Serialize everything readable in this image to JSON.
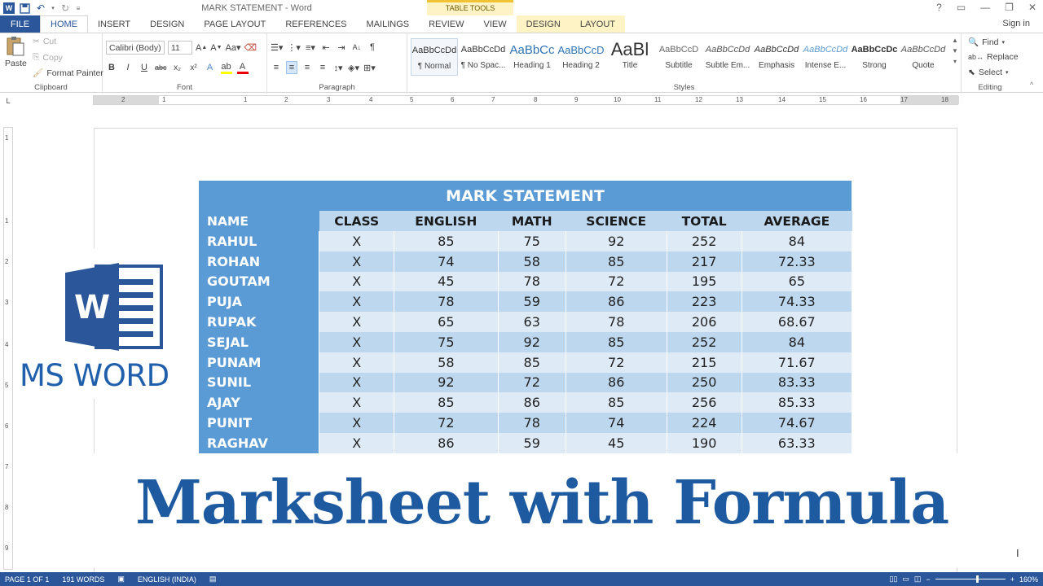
{
  "window": {
    "title": "MARK STATEMENT - Word",
    "table_tools": "TABLE TOOLS",
    "sign_in": "Sign in",
    "controls": [
      "?",
      "▭",
      "—",
      "❐",
      "✕"
    ]
  },
  "tabs": [
    {
      "label": "FILE"
    },
    {
      "label": "HOME"
    },
    {
      "label": "INSERT"
    },
    {
      "label": "DESIGN"
    },
    {
      "label": "PAGE LAYOUT"
    },
    {
      "label": "REFERENCES"
    },
    {
      "label": "MAILINGS"
    },
    {
      "label": "REVIEW"
    },
    {
      "label": "VIEW"
    },
    {
      "label": "DESIGN"
    },
    {
      "label": "LAYOUT"
    }
  ],
  "clipboard": {
    "paste": "Paste",
    "cut": "Cut",
    "copy": "Copy",
    "format_painter": "Format Painter",
    "label": "Clipboard"
  },
  "font": {
    "name": "Calibri (Body)",
    "size": "11",
    "label": "Font"
  },
  "paragraph": {
    "label": "Paragraph"
  },
  "styles": {
    "label": "Styles",
    "items": [
      {
        "sample": "AaBbCcDd",
        "name": "¶ Normal"
      },
      {
        "sample": "AaBbCcDd",
        "name": "¶ No Spac..."
      },
      {
        "sample": "AaBbCc",
        "name": "Heading 1"
      },
      {
        "sample": "AaBbCcD",
        "name": "Heading 2"
      },
      {
        "sample": "AaBl",
        "name": "Title"
      },
      {
        "sample": "AaBbCcD",
        "name": "Subtitle"
      },
      {
        "sample": "AaBbCcDd",
        "name": "Subtle Em..."
      },
      {
        "sample": "AaBbCcDd",
        "name": "Emphasis"
      },
      {
        "sample": "AaBbCcDd",
        "name": "Intense E..."
      },
      {
        "sample": "AaBbCcDc",
        "name": "Strong"
      },
      {
        "sample": "AaBbCcDd",
        "name": "Quote"
      }
    ]
  },
  "editing": {
    "find": "Find",
    "replace": "Replace",
    "select": "Select",
    "label": "Editing"
  },
  "ruler": {
    "marks": [
      "2",
      "1",
      "1",
      "2",
      "3",
      "4",
      "5",
      "6",
      "7",
      "8",
      "9",
      "10",
      "11",
      "12",
      "13",
      "14",
      "15",
      "16",
      "17",
      "18"
    ],
    "vmarks": [
      "1",
      "1",
      "2",
      "3",
      "4",
      "5",
      "6",
      "7",
      "8",
      "9"
    ],
    "corner": "L"
  },
  "table": {
    "title": "MARK STATEMENT",
    "headers": [
      "NAME",
      "CLASS",
      "ENGLISH",
      "MATH",
      "SCIENCE",
      "TOTAL",
      "AVERAGE"
    ],
    "rows": [
      [
        "RAHUL",
        "X",
        "85",
        "75",
        "92",
        "252",
        "84"
      ],
      [
        "ROHAN",
        "X",
        "74",
        "58",
        "85",
        "217",
        "72.33"
      ],
      [
        "GOUTAM",
        "X",
        "45",
        "78",
        "72",
        "195",
        "65"
      ],
      [
        "PUJA",
        "X",
        "78",
        "59",
        "86",
        "223",
        "74.33"
      ],
      [
        "RUPAK",
        "X",
        "65",
        "63",
        "78",
        "206",
        "68.67"
      ],
      [
        "SEJAL",
        "X",
        "75",
        "92",
        "85",
        "252",
        "84"
      ],
      [
        "PUNAM",
        "X",
        "58",
        "85",
        "72",
        "215",
        "71.67"
      ],
      [
        "SUNIL",
        "X",
        "92",
        "72",
        "86",
        "250",
        "83.33"
      ],
      [
        "AJAY",
        "X",
        "85",
        "86",
        "85",
        "256",
        "85.33"
      ],
      [
        "PUNIT",
        "X",
        "72",
        "78",
        "74",
        "224",
        "74.67"
      ],
      [
        "RAGHAV",
        "X",
        "86",
        "59",
        "45",
        "190",
        "63.33"
      ]
    ]
  },
  "overlay": {
    "logo_letter": "W",
    "ms_word": "MS WORD",
    "headline": "Marksheet with Formula"
  },
  "status": {
    "page": "PAGE 1 OF 1",
    "words": "191 WORDS",
    "language": "ENGLISH (INDIA)",
    "zoom": "160%",
    "zoom_level": 0.6
  },
  "colors": {
    "word_blue": "#2b579a",
    "table_header": "#5b9bd5",
    "band_dark": "#bdd7ee",
    "band_light": "#deebf7",
    "headline": "#1e5aa0"
  }
}
